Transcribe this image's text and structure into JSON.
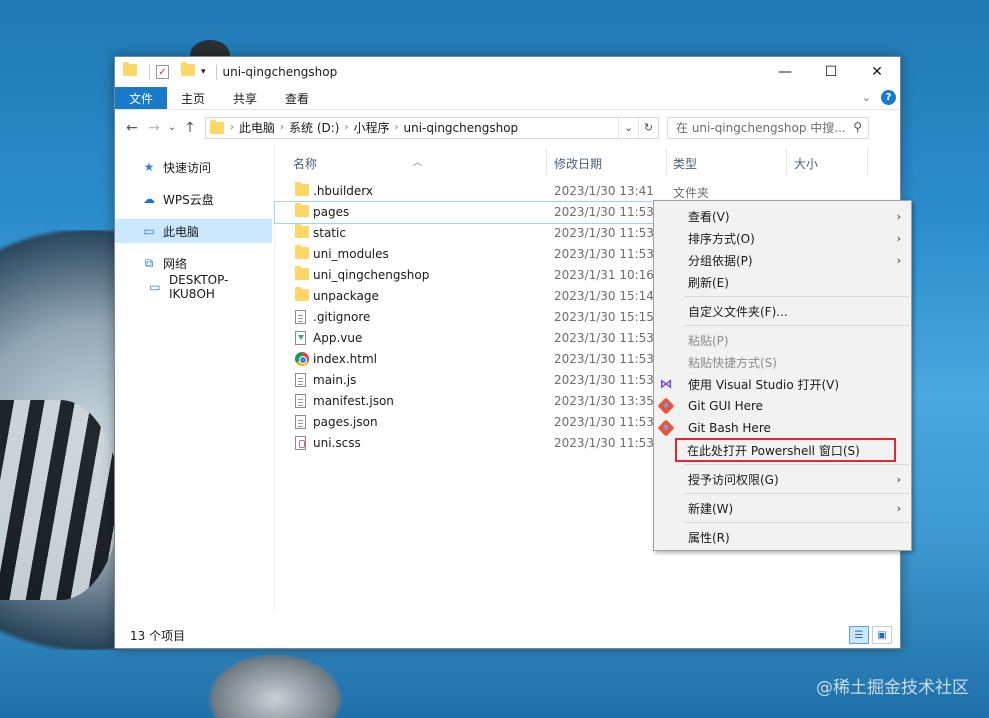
{
  "window": {
    "title": "uni-qingchengshop",
    "controls": {
      "minimize": "—",
      "maximize": "☐",
      "close": "✕"
    }
  },
  "ribbon": {
    "tabs": [
      "文件",
      "主页",
      "共享",
      "查看"
    ]
  },
  "nav": {
    "back": "←",
    "forward": "→",
    "recent": "⌄",
    "up": "↑",
    "breadcrumb": [
      "此电脑",
      "系统 (D:)",
      "小程序",
      "uni-qingchengshop"
    ],
    "search_placeholder": "在 uni-qingchengshop 中搜..."
  },
  "sidebar": {
    "items": [
      {
        "label": "快速访问",
        "icon": "star-icon"
      },
      {
        "label": "WPS云盘",
        "icon": "cloud-icon"
      },
      {
        "label": "此电脑",
        "icon": "computer-icon"
      },
      {
        "label": "网络",
        "icon": "network-icon"
      },
      {
        "label": "DESKTOP-IKU8OH",
        "icon": "monitor-icon"
      }
    ]
  },
  "columns": {
    "name": "名称",
    "date": "修改日期",
    "type": "类型",
    "size": "大小"
  },
  "files": [
    {
      "name": ".hbuilderx",
      "date": "2023/1/30 13:41",
      "type": "文件夹",
      "kind": "folder"
    },
    {
      "name": "pages",
      "date": "2023/1/30 11:53",
      "type": "",
      "kind": "folder"
    },
    {
      "name": "static",
      "date": "2023/1/30 11:53",
      "type": "",
      "kind": "folder"
    },
    {
      "name": "uni_modules",
      "date": "2023/1/30 11:53",
      "type": "",
      "kind": "folder"
    },
    {
      "name": "uni_qingchengshop",
      "date": "2023/1/31 10:16",
      "type": "",
      "kind": "folder"
    },
    {
      "name": "unpackage",
      "date": "2023/1/30 15:14",
      "type": "",
      "kind": "folder"
    },
    {
      "name": ".gitignore",
      "date": "2023/1/30 15:15",
      "type": "",
      "kind": "doc"
    },
    {
      "name": "App.vue",
      "date": "2023/1/30 11:53",
      "type": "",
      "kind": "vue"
    },
    {
      "name": "index.html",
      "date": "2023/1/30 11:53",
      "type": "",
      "kind": "chrome"
    },
    {
      "name": "main.js",
      "date": "2023/1/30 11:53",
      "type": "",
      "kind": "doc"
    },
    {
      "name": "manifest.json",
      "date": "2023/1/30 13:35",
      "type": "",
      "kind": "doc"
    },
    {
      "name": "pages.json",
      "date": "2023/1/30 11:53",
      "type": "",
      "kind": "doc"
    },
    {
      "name": "uni.scss",
      "date": "2023/1/30 11:53",
      "type": "",
      "kind": "scss"
    }
  ],
  "status": {
    "count": "13 个项目"
  },
  "context_menu": {
    "view": "查看(V)",
    "sort": "排序方式(O)",
    "group": "分组依据(P)",
    "refresh": "刷新(E)",
    "customize": "自定义文件夹(F)...",
    "paste": "粘贴(P)",
    "paste_shortcut": "粘贴快捷方式(S)",
    "open_vs": "使用 Visual Studio 打开(V)",
    "git_gui": "Git GUI Here",
    "git_bash": "Git Bash Here",
    "powershell": "在此处打开 Powershell 窗口(S)",
    "grant_access": "授予访问权限(G)",
    "new": "新建(W)",
    "properties": "属性(R)"
  },
  "watermark": "@稀土掘金技术社区",
  "colors": {
    "accent": "#1979ca",
    "highlight_border": "#e0282e",
    "selection": "#cce8ff"
  }
}
